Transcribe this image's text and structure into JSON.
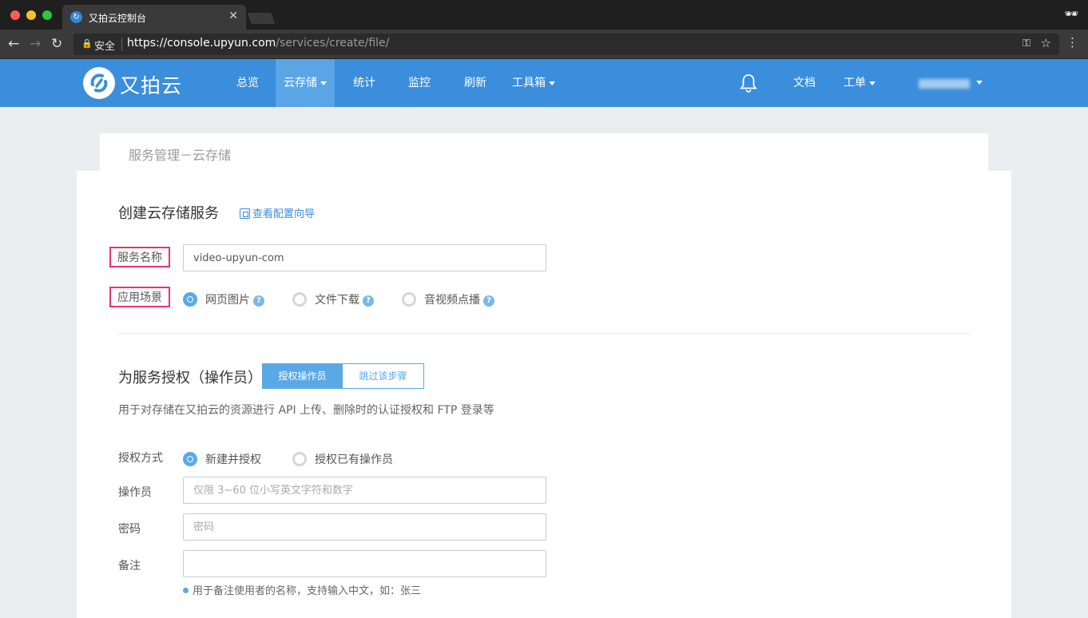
{
  "browser": {
    "tab_title": "又拍云控制台",
    "secure_label": "安全",
    "url_host": "https://console.upyun.com",
    "url_path": "/services/create/file/"
  },
  "nav": {
    "logo_text": "又拍云",
    "items": [
      {
        "label": "总览"
      },
      {
        "label": "云存储",
        "active": true,
        "dropdown": true
      },
      {
        "label": "统计"
      },
      {
        "label": "监控"
      },
      {
        "label": "刷新"
      },
      {
        "label": "工具箱",
        "dropdown": true
      }
    ],
    "docs_label": "文档",
    "ticket_label": "工单"
  },
  "breadcrumb": "服务管理－云存储",
  "create": {
    "title": "创建云存储服务",
    "guide_link": "查看配置向导",
    "service_name_label": "服务名称",
    "service_name_value": "video-upyun-com",
    "scenario_label": "应用场景",
    "scenarios": [
      {
        "label": "网页图片",
        "selected": true
      },
      {
        "label": "文件下载",
        "selected": false
      },
      {
        "label": "音视频点播",
        "selected": false
      }
    ]
  },
  "auth": {
    "title": "为服务授权（操作员）",
    "btn_authorize": "授权操作员",
    "btn_skip": "跳过该步骤",
    "description": "用于对存储在又拍云的资源进行 API 上传、删除时的认证授权和 FTP 登录等",
    "method_label": "授权方式",
    "methods": [
      {
        "label": "新建并授权",
        "selected": true
      },
      {
        "label": "授权已有操作员",
        "selected": false
      }
    ],
    "operator_label": "操作员",
    "operator_placeholder": "仅限 3~60 位小写英文字符和数字",
    "password_label": "密码",
    "password_placeholder": "密码",
    "remark_label": "备注",
    "remark_hint": "用于备注使用者的名称，支持输入中文，如：张三"
  },
  "colors": {
    "brand_blue": "#3a8edb",
    "accent_blue": "#5aa9e6",
    "highlight_pink": "#e8336e"
  }
}
